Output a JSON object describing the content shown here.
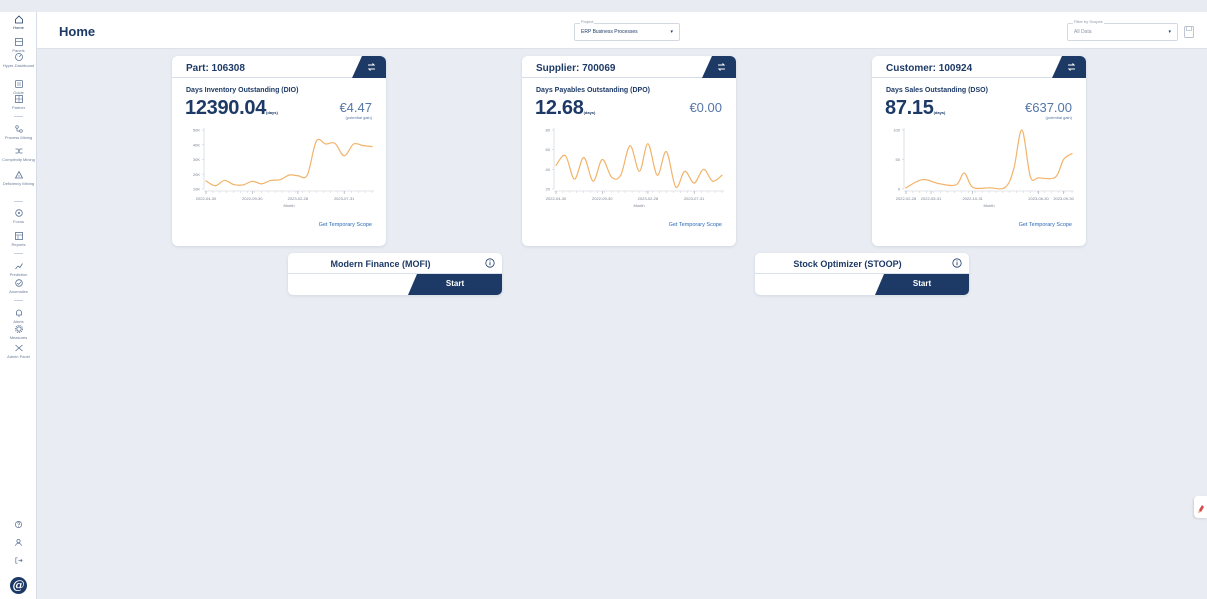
{
  "header": {
    "title": "Home",
    "project_label": "Project",
    "project_value": "ERP Business Processes",
    "scope_label": "Filter by Scopes",
    "scope_value": "All Data"
  },
  "sidebar": {
    "items": [
      {
        "label": "Home",
        "icon": "home-icon"
      },
      {
        "label": "Panels",
        "icon": "panels-icon"
      },
      {
        "label": "Hyper-Dashboard",
        "icon": "hyper-dashboard-icon"
      },
      {
        "label": "Guide",
        "icon": "guide-icon"
      },
      {
        "label": "Partner",
        "icon": "partner-icon"
      },
      {
        "label": "Process Mining",
        "icon": "process-mining-icon"
      },
      {
        "label": "Complexity Mining",
        "icon": "complexity-mining-icon"
      },
      {
        "label": "Deficiency Mining",
        "icon": "deficiency-mining-icon"
      },
      {
        "label": "Focus",
        "icon": "focus-icon"
      },
      {
        "label": "Reports",
        "icon": "reports-icon"
      },
      {
        "label": "Prediction",
        "icon": "prediction-icon"
      },
      {
        "label": "Anomalies",
        "icon": "anomalies-icon"
      },
      {
        "label": "Alerts",
        "icon": "bell-icon"
      },
      {
        "label": "Measures",
        "icon": "gear-icon"
      },
      {
        "label": "Admin Panel",
        "icon": "admin-icon"
      }
    ],
    "bottom_icons": [
      "help-icon",
      "user-icon",
      "logout-icon"
    ],
    "brand_glyph": "@"
  },
  "cards": [
    {
      "title": "Part: 106308",
      "metric_name": "Days Inventory Outstanding (DIO)",
      "metric_value": "12390.04",
      "metric_unit": "(days)",
      "gain_value": "€4.47",
      "gain_label": "(potential gain)",
      "link": "Get Temporary Scope",
      "xlabel": "Month"
    },
    {
      "title": "Supplier: 700069",
      "metric_name": "Days Payables Outstanding (DPO)",
      "metric_value": "12.68",
      "metric_unit": "(days)",
      "gain_value": "€0.00",
      "gain_label": "",
      "link": "Get Temporary Scope",
      "xlabel": "Month"
    },
    {
      "title": "Customer: 100924",
      "metric_name": "Days Sales Outstanding (DSO)",
      "metric_value": "87.15",
      "metric_unit": "(days)",
      "gain_value": "€637.00",
      "gain_label": "(potential gain)",
      "link": "Get Temporary Scope",
      "xlabel": "Month"
    }
  ],
  "tools": [
    {
      "title": "Modern Finance (MOFI)",
      "start": "Start"
    },
    {
      "title": "Stock Optimizer (STOOP)",
      "start": "Start"
    }
  ],
  "colors": {
    "primary": "#1d3a66",
    "line": "#f2b36a",
    "link": "#2b6ab8",
    "gain": "#5576a8",
    "background": "#e9edf3"
  },
  "chart_data": [
    {
      "type": "line",
      "title": "",
      "xlabel": "Month",
      "ylabel": "",
      "ylim": [
        10000,
        50000
      ],
      "yticks": [
        "10K",
        "20K",
        "30K",
        "40K",
        "50K"
      ],
      "xticks": [
        "2022-04-30",
        "2022-09-30",
        "2023-02-28",
        "2023-07-31"
      ],
      "points": [
        {
          "x": "2022-04-30",
          "y": 15500
        },
        {
          "x": "2022-05-31",
          "y": 12200
        },
        {
          "x": "2022-06-30",
          "y": 15800
        },
        {
          "x": "2022-07-31",
          "y": 13000
        },
        {
          "x": "2022-08-31",
          "y": 12800
        },
        {
          "x": "2022-09-30",
          "y": 15200
        },
        {
          "x": "2022-10-31",
          "y": 13500
        },
        {
          "x": "2022-11-30",
          "y": 15800
        },
        {
          "x": "2022-12-31",
          "y": 16300
        },
        {
          "x": "2023-01-31",
          "y": 19500
        },
        {
          "x": "2023-02-28",
          "y": 19000
        },
        {
          "x": "2023-03-31",
          "y": 19500
        },
        {
          "x": "2023-04-30",
          "y": 42500
        },
        {
          "x": "2023-05-31",
          "y": 40500
        },
        {
          "x": "2023-06-30",
          "y": 41000
        },
        {
          "x": "2023-07-31",
          "y": 32500
        },
        {
          "x": "2023-08-31",
          "y": 40500
        },
        {
          "x": "2023-09-30",
          "y": 39500
        },
        {
          "x": "2023-10-31",
          "y": 38800
        }
      ]
    },
    {
      "type": "line",
      "title": "",
      "xlabel": "Month",
      "ylabel": "",
      "ylim": [
        20,
        80
      ],
      "yticks": [
        "20",
        "40",
        "60",
        "80"
      ],
      "xticks": [
        "2022-04-30",
        "2022-09-30",
        "2023-02-28",
        "2023-07-31"
      ],
      "points": [
        {
          "x": "2022-04-30",
          "y": 44
        },
        {
          "x": "2022-05-31",
          "y": 54
        },
        {
          "x": "2022-06-30",
          "y": 30
        },
        {
          "x": "2022-07-31",
          "y": 52
        },
        {
          "x": "2022-08-31",
          "y": 28
        },
        {
          "x": "2022-09-30",
          "y": 50
        },
        {
          "x": "2022-10-31",
          "y": 32
        },
        {
          "x": "2022-11-30",
          "y": 34
        },
        {
          "x": "2022-12-31",
          "y": 64
        },
        {
          "x": "2023-01-31",
          "y": 38
        },
        {
          "x": "2023-02-28",
          "y": 66
        },
        {
          "x": "2023-03-31",
          "y": 34
        },
        {
          "x": "2023-04-30",
          "y": 58
        },
        {
          "x": "2023-05-31",
          "y": 22
        },
        {
          "x": "2023-06-30",
          "y": 38
        },
        {
          "x": "2023-07-31",
          "y": 26
        },
        {
          "x": "2023-08-31",
          "y": 40
        },
        {
          "x": "2023-09-30",
          "y": 28
        },
        {
          "x": "2023-10-31",
          "y": 34
        }
      ]
    },
    {
      "type": "line",
      "title": "",
      "xlabel": "Month",
      "ylabel": "",
      "ylim": [
        0,
        100
      ],
      "yticks": [
        "0",
        "50",
        "100"
      ],
      "xticks": [
        "2022-02-28",
        "2022-05-31",
        "2022-10-31",
        "2023-06-30",
        "2023-09-30"
      ],
      "points": [
        {
          "x": "2022-02-28",
          "y": 2
        },
        {
          "x": "2022-04-30",
          "y": 16
        },
        {
          "x": "2022-06-30",
          "y": 9
        },
        {
          "x": "2022-08-31",
          "y": 7
        },
        {
          "x": "2022-09-30",
          "y": 27
        },
        {
          "x": "2022-10-31",
          "y": 3
        },
        {
          "x": "2022-12-31",
          "y": 2
        },
        {
          "x": "2023-02-28",
          "y": 3
        },
        {
          "x": "2023-03-31",
          "y": 34
        },
        {
          "x": "2023-04-30",
          "y": 100
        },
        {
          "x": "2023-05-31",
          "y": 21
        },
        {
          "x": "2023-06-30",
          "y": 19
        },
        {
          "x": "2023-08-31",
          "y": 20
        },
        {
          "x": "2023-09-30",
          "y": 50
        },
        {
          "x": "2023-10-31",
          "y": 60
        }
      ]
    }
  ]
}
